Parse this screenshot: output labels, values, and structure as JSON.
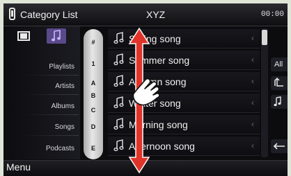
{
  "header": {
    "title": "Category List",
    "source_label": "XYZ",
    "clock": "00:00"
  },
  "categories": [
    {
      "label": "Playlists"
    },
    {
      "label": "Artists"
    },
    {
      "label": "Albums"
    },
    {
      "label": "Songs"
    },
    {
      "label": "Podcasts"
    }
  ],
  "alphabet": [
    "#",
    "1",
    "A",
    "B",
    "C",
    "D",
    "E"
  ],
  "songs": [
    {
      "name": "Spring song"
    },
    {
      "name": "Summer song"
    },
    {
      "name": "Autumn song"
    },
    {
      "name": "Winter song"
    },
    {
      "name": "Morning song"
    },
    {
      "name": "Afternoon song"
    }
  ],
  "side_buttons": [
    {
      "label": "All",
      "icon": "all-text"
    },
    {
      "label": "",
      "icon": "up-folder-icon"
    },
    {
      "label": "",
      "icon": "music-list-icon"
    },
    {
      "label": "",
      "icon": "back-arrow-icon"
    }
  ],
  "footer": {
    "menu_label": "Menu"
  },
  "gesture": {
    "type": "flick-vertical",
    "icon": "hand-pointer-icon",
    "arrow_color": "#e0342a"
  }
}
